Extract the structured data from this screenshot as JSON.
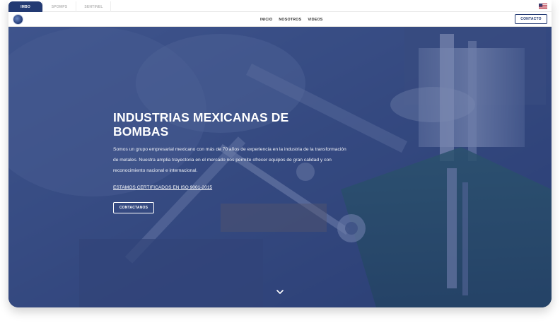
{
  "brand_tabs": [
    {
      "label": "IMBO",
      "active": true
    },
    {
      "label": "SPOMPS",
      "active": false
    },
    {
      "label": "SENTINEL",
      "active": false
    }
  ],
  "language_flag": "us-flag-icon",
  "nav": {
    "links": [
      "INICIO",
      "NOSOTROS",
      "VIDEOS"
    ],
    "contact_label": "CONTACTO"
  },
  "hero": {
    "title": "INDUSTRIAS MEXICANAS DE BOMBAS",
    "description": "Somos un grupo empresarial mexicano con más de 70 años de experiencia en la industria de la transformación de metales. Nuestra amplia trayectoria en el mercado nos permite ofrecer equipos de gran calidad y con reconocimiento nacional e internacional.",
    "certification_link": "ESTAMOS CERTIFICADOS EN ISO 9001-2015",
    "cta_label": "CONTACTANOS",
    "scroll_icon": "chevron-down-icon"
  },
  "colors": {
    "brand_navy": "#233a73",
    "overlay": "#2d4277"
  }
}
